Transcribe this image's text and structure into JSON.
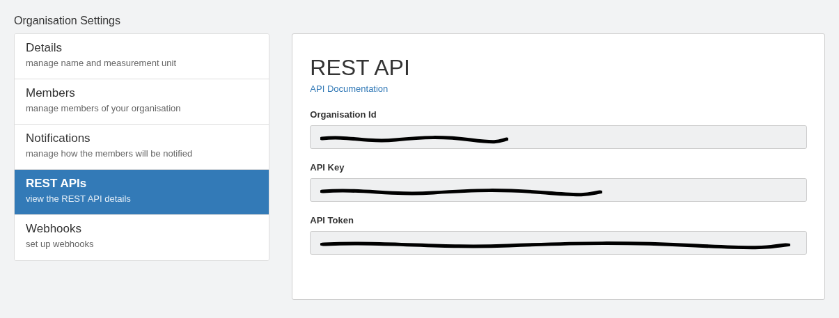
{
  "page_title": "Organisation Settings",
  "sidebar": {
    "items": [
      {
        "title": "Details",
        "subtitle": "manage name and measurement unit",
        "selected": false
      },
      {
        "title": "Members",
        "subtitle": "manage members of your organisation",
        "selected": false
      },
      {
        "title": "Notifications",
        "subtitle": "manage how the members will be notified",
        "selected": false
      },
      {
        "title": "REST APIs",
        "subtitle": "view the REST API details",
        "selected": true
      },
      {
        "title": "Webhooks",
        "subtitle": "set up webhooks",
        "selected": false
      }
    ]
  },
  "panel": {
    "heading": "REST API",
    "link": "API Documentation",
    "fields": [
      {
        "label": "Organisation Id",
        "redacted": true
      },
      {
        "label": "API Key",
        "redacted": true
      },
      {
        "label": "API Token",
        "redacted": true
      }
    ]
  }
}
